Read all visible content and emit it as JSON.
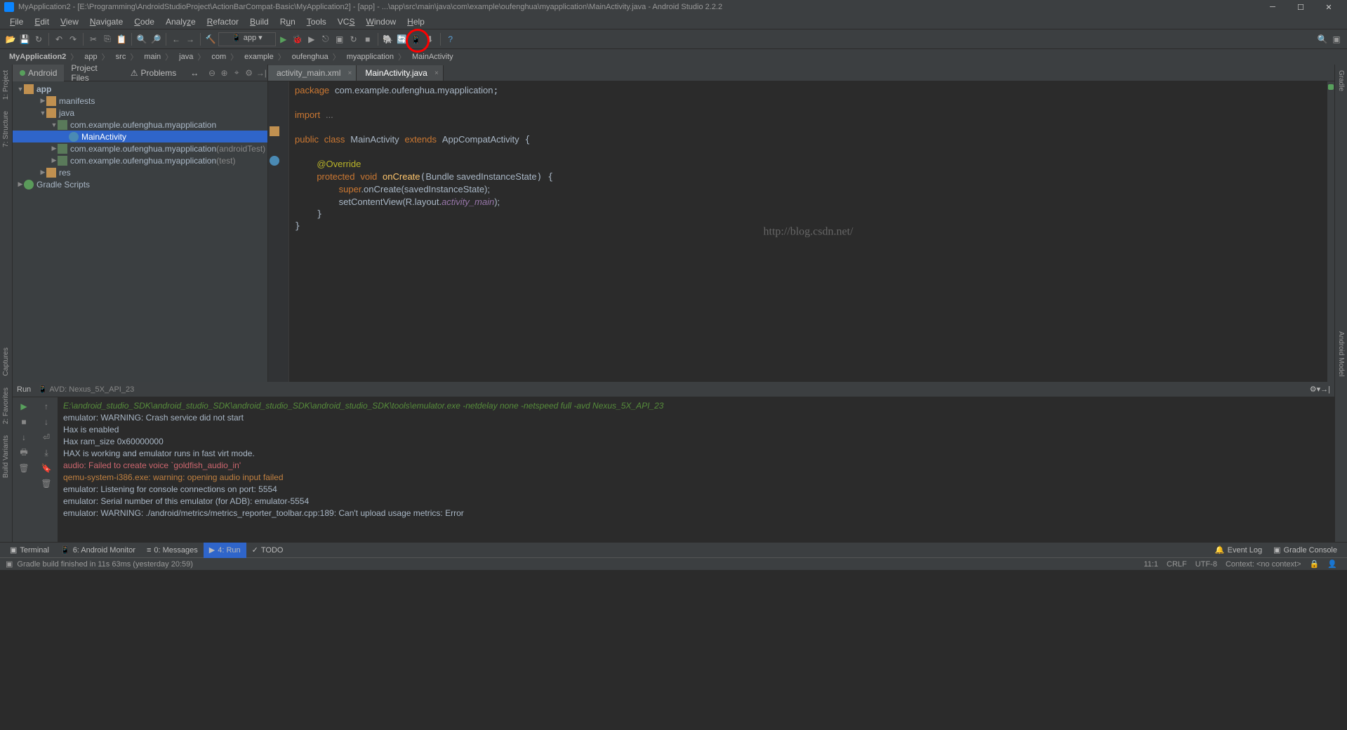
{
  "title": "MyApplication2 - [E:\\Programming\\AndroidStudioProject\\ActionBarCompat-Basic\\MyApplication2] - [app] - ...\\app\\src\\main\\java\\com\\example\\oufenghua\\myapplication\\MainActivity.java - Android Studio 2.2.2",
  "menu": [
    "File",
    "Edit",
    "View",
    "Navigate",
    "Code",
    "Analyze",
    "Refactor",
    "Build",
    "Run",
    "Tools",
    "VCS",
    "Window",
    "Help"
  ],
  "toolbar": {
    "config": "app"
  },
  "breadcrumb": [
    "MyApplication2",
    "app",
    "src",
    "main",
    "java",
    "com",
    "example",
    "oufenghua",
    "myapplication",
    "MainActivity"
  ],
  "proj_tabs": [
    "Android",
    "Project Files",
    "Problems"
  ],
  "tree": {
    "root": "app",
    "nodes": [
      {
        "label": "manifests",
        "indent": 2,
        "icon": "folder",
        "arrow": "right"
      },
      {
        "label": "java",
        "indent": 2,
        "icon": "folder",
        "arrow": "down"
      },
      {
        "label": "com.example.oufenghua.myapplication",
        "indent": 3,
        "icon": "pkg",
        "arrow": "down"
      },
      {
        "label": "MainActivity",
        "indent": 4,
        "icon": "class",
        "arrow": "none",
        "selected": true
      },
      {
        "label": "com.example.oufenghua.myapplication",
        "suffix": "(androidTest)",
        "indent": 3,
        "icon": "pkg",
        "arrow": "right"
      },
      {
        "label": "com.example.oufenghua.myapplication",
        "suffix": "(test)",
        "indent": 3,
        "icon": "pkg",
        "arrow": "right"
      },
      {
        "label": "res",
        "indent": 2,
        "icon": "folder",
        "arrow": "right"
      }
    ],
    "gradle": "Gradle Scripts"
  },
  "editor_tabs": [
    {
      "name": "activity_main.xml",
      "active": false
    },
    {
      "name": "MainActivity.java",
      "active": true
    }
  ],
  "code": {
    "package": "package",
    "pkgpath": "com.example.oufenghua.myapplication",
    "import": "import",
    "dots": "...",
    "public": "public",
    "class": "class",
    "name": "MainActivity",
    "extends": "extends",
    "parent": "AppCompatActivity",
    "override": "@Override",
    "protected": "protected",
    "void": "void",
    "onCreate": "onCreate",
    "param": "Bundle savedInstanceState",
    "super": "super",
    "superCall": ".onCreate(savedInstanceState);",
    "setContent": "setContentView(R.layout.",
    "layout": "activity_main",
    "closeParen": ");"
  },
  "watermark": "http://blog.csdn.net/",
  "run": {
    "title": "Run",
    "config": "AVD: Nexus_5X_API_23",
    "lines": [
      {
        "cls": "green",
        "text": "E:\\android_studio_SDK\\android_studio_SDK\\android_studio_SDK\\android_studio_SDK\\tools\\emulator.exe -netdelay none -netspeed full -avd Nexus_5X_API_23"
      },
      {
        "cls": "",
        "text": "emulator: WARNING: Crash service did not start"
      },
      {
        "cls": "",
        "text": "Hax is enabled"
      },
      {
        "cls": "",
        "text": "Hax ram_size 0x60000000"
      },
      {
        "cls": "",
        "text": "HAX is working and emulator runs in fast virt mode."
      },
      {
        "cls": "red",
        "text": "audio: Failed to create voice `goldfish_audio_in'"
      },
      {
        "cls": "orange",
        "text": "qemu-system-i386.exe: warning: opening audio input failed"
      },
      {
        "cls": "",
        "text": "emulator: Listening for console connections on port: 5554"
      },
      {
        "cls": "",
        "text": "emulator: Serial number of this emulator (for ADB): emulator-5554"
      },
      {
        "cls": "",
        "text": "emulator: WARNING: ./android/metrics/metrics_reporter_toolbar.cpp:189: Can't upload usage metrics: Error"
      }
    ]
  },
  "bottom": {
    "terminal": "Terminal",
    "monitor": "6: Android Monitor",
    "messages": "0: Messages",
    "run": "4: Run",
    "todo": "TODO",
    "eventlog": "Event Log",
    "gradleconsole": "Gradle Console"
  },
  "status": {
    "msg": "Gradle build finished in 11s 63ms (yesterday 20:59)",
    "pos": "11:1",
    "crlf": "CRLF",
    "enc": "UTF-8",
    "ctx": "Context: <no context>"
  },
  "left_buttons": [
    "1: Project",
    "7: Structure",
    "Captures"
  ],
  "right_buttons": [
    "Gradle",
    "Android Model"
  ],
  "side_extra": [
    "2: Favorites",
    "Build Variants"
  ]
}
